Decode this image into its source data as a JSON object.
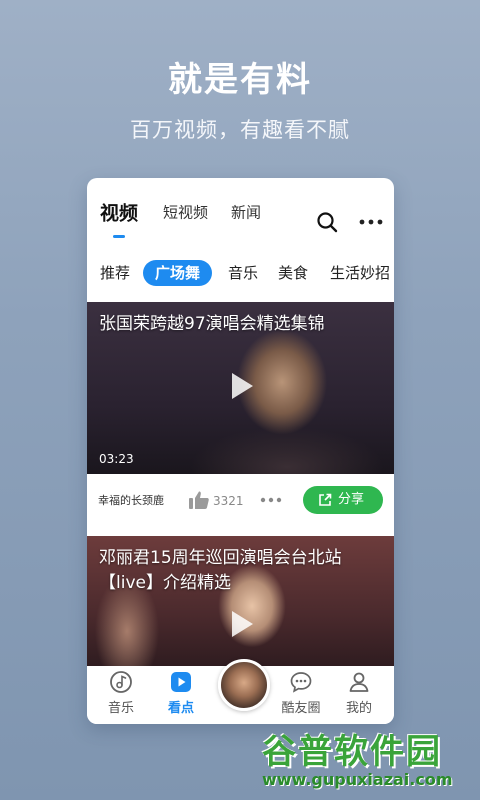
{
  "promo": {
    "title": "就是有料",
    "subtitle": "百万视频，有趣看不腻"
  },
  "header": {
    "tabs": [
      "视频",
      "短视频",
      "新闻"
    ],
    "active_tab": "视频",
    "search_icon": "search-icon",
    "more_icon": "more-icon"
  },
  "chips": [
    "推荐",
    "广场舞",
    "音乐",
    "美食",
    "生活妙招"
  ],
  "chips_active": "广场舞",
  "videos": [
    {
      "title": "张国荣跨越97演唱会精选集锦",
      "duration": "03:23",
      "author": "幸福的长颈鹿",
      "likes": "3321",
      "share_label": "分享"
    },
    {
      "title": "邓丽君15周年巡回演唱会台北站【live】介绍精选"
    }
  ],
  "bottom_nav": [
    {
      "label": "音乐",
      "icon": "music-icon"
    },
    {
      "label": "看点",
      "icon": "play-square-icon",
      "active": true
    },
    {
      "label": "",
      "icon": "avatar"
    },
    {
      "label": "酷友圈",
      "icon": "chat-icon"
    },
    {
      "label": "我的",
      "icon": "person-icon"
    }
  ],
  "watermark": {
    "main": "谷普软件园",
    "sub": "www.gupuxiazai.com"
  },
  "colors": {
    "accent": "#1e8bf0",
    "share_green": "#2fb750",
    "watermark_green": "#3aa43a"
  }
}
